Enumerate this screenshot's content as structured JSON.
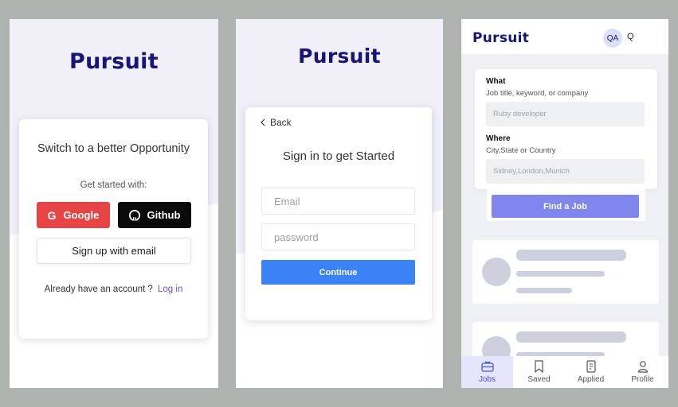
{
  "screen1": {
    "logo": "Pursuit",
    "card_title": "Switch to a better Opportunity",
    "get_started": "Get started with:",
    "google_label": "Google",
    "github_label": "Github",
    "email_signup_label": "Sign up with email",
    "already_text": "Already have an account ?",
    "login_link": "Log in"
  },
  "screen2": {
    "logo": "Pursuit",
    "back_label": "Back",
    "title": "Sign in to get Started",
    "email_placeholder": "Email",
    "password_placeholder": "password",
    "continue_label": "Continue"
  },
  "screen3": {
    "logo": "Pursuit",
    "avatar_initials": "QA",
    "search_text": "Q",
    "what_label": "What",
    "what_hint": "Job title, keyword, or company",
    "what_placeholder": "Ruby developer",
    "where_label": "Where",
    "where_hint": "City,State or Country",
    "where_placeholder": "Sidney,London,Munich",
    "find_label": "Find a Job",
    "nav": [
      {
        "label": "Jobs",
        "icon": "briefcase-icon",
        "active": true
      },
      {
        "label": "Saved",
        "icon": "bookmark-icon",
        "active": false
      },
      {
        "label": "Applied",
        "icon": "document-icon",
        "active": false
      },
      {
        "label": "Profile",
        "icon": "user-icon",
        "active": false
      }
    ]
  },
  "colors": {
    "background": "#aeb3b0",
    "logo": "#15157a",
    "lavender": "#f1f0f9",
    "google": "#e74545",
    "github": "#0a0a0a",
    "continue": "#3b82f6",
    "find_job": "#7f86ec",
    "link": "#6b4fd8",
    "skeleton": "#cdd1de",
    "nav_active_bg": "#e5e6fb"
  }
}
